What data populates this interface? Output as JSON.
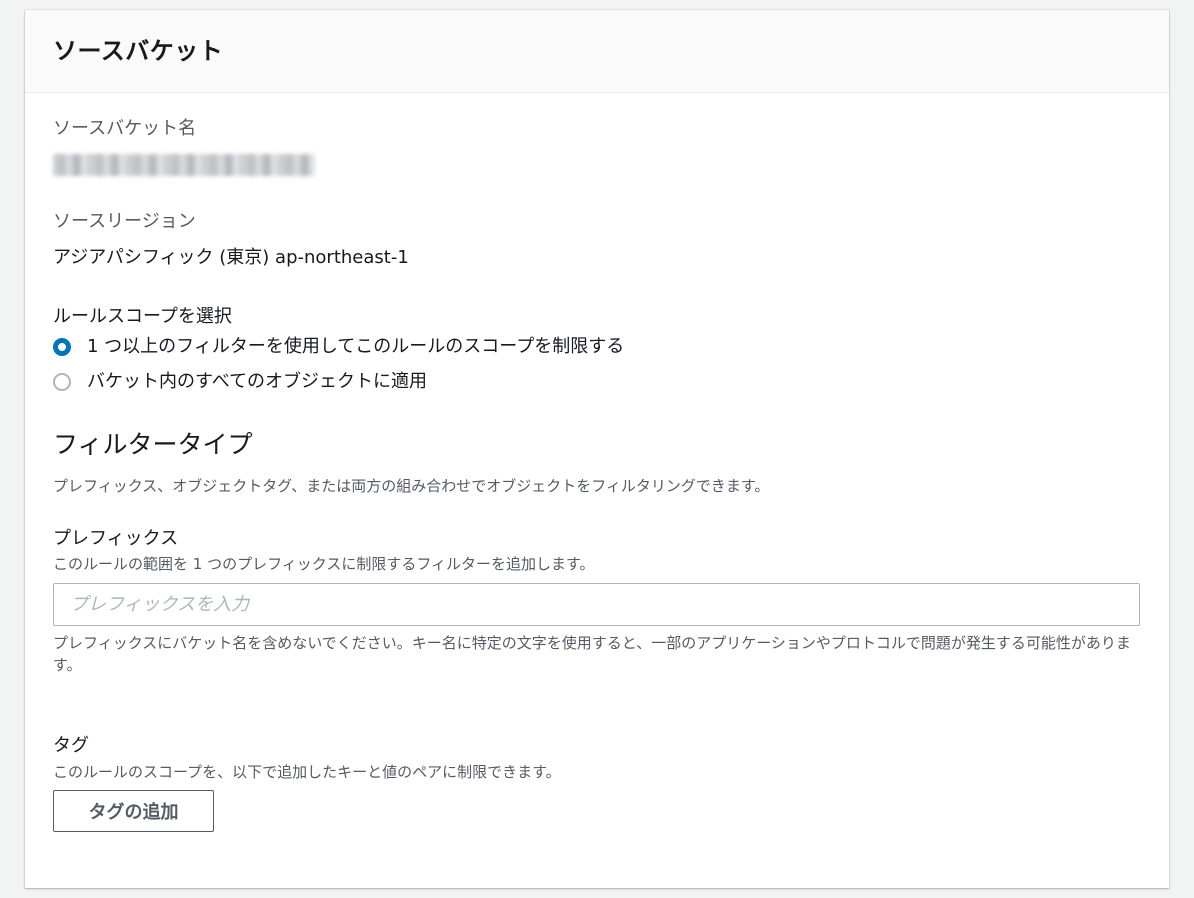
{
  "panel": {
    "title": "ソースバケット"
  },
  "source_bucket_name": {
    "label": "ソースバケット名",
    "value_redacted": true
  },
  "source_region": {
    "label": "ソースリージョン",
    "value": "アジアパシフィック (東京) ap-northeast-1"
  },
  "rule_scope": {
    "label": "ルールスコープを選択",
    "options": [
      {
        "label": "1 つ以上のフィルターを使用してこのルールのスコープを制限する",
        "checked": true
      },
      {
        "label": "バケット内のすべてのオブジェクトに適用",
        "checked": false
      }
    ]
  },
  "filter_type": {
    "heading": "フィルタータイプ",
    "description": "プレフィックス、オブジェクトタグ、または両方の組み合わせでオブジェクトをフィルタリングできます。"
  },
  "prefix": {
    "label": "プレフィックス",
    "description": "このルールの範囲を 1 つのプレフィックスに制限するフィルターを追加します。",
    "placeholder": "プレフィックスを入力",
    "value": "",
    "hint": "プレフィックスにバケット名を含めないでください。キー名に特定の文字を使用すると、一部のアプリケーションやプロトコルで問題が発生する可能性があります。"
  },
  "tags": {
    "label": "タグ",
    "description": "このルールのスコープを、以下で追加したキーと値のペアに制限できます。",
    "add_button": "タグの追加"
  },
  "colors": {
    "accent": "#0073bb",
    "text": "#16191f",
    "secondary_text": "#545b64",
    "border": "#aab7b8"
  }
}
